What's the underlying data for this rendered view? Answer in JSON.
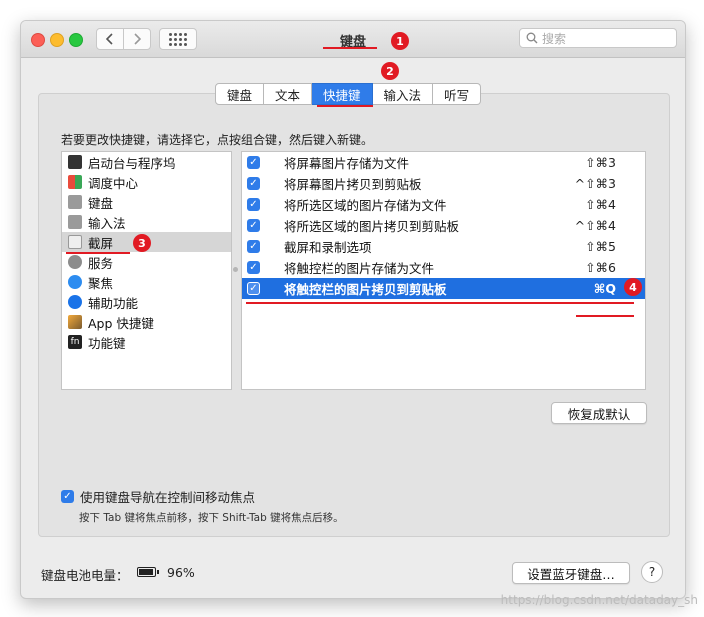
{
  "window": {
    "title": "键盘",
    "search_placeholder": "搜索"
  },
  "tabs": [
    {
      "label": "键盘",
      "active": false
    },
    {
      "label": "文本",
      "active": false
    },
    {
      "label": "快捷键",
      "active": true
    },
    {
      "label": "输入法",
      "active": false
    },
    {
      "label": "听写",
      "active": false
    }
  ],
  "instruction": "若要更改快捷键，请选择它，点按组合键，然后键入新键。",
  "categories": [
    {
      "label": "启动台与程序坞",
      "icon": "launchpad-icon"
    },
    {
      "label": "调度中心",
      "icon": "mission-control-icon"
    },
    {
      "label": "键盘",
      "icon": "keyboard-icon"
    },
    {
      "label": "输入法",
      "icon": "input-method-icon"
    },
    {
      "label": "截屏",
      "icon": "screenshot-icon",
      "selected": true
    },
    {
      "label": "服务",
      "icon": "services-gear-icon"
    },
    {
      "label": "聚焦",
      "icon": "spotlight-icon"
    },
    {
      "label": "辅助功能",
      "icon": "accessibility-icon"
    },
    {
      "label": "App 快捷键",
      "icon": "app-shortcuts-icon"
    },
    {
      "label": "功能键",
      "icon": "fn-key-icon",
      "glyph": "fn"
    }
  ],
  "shortcuts": [
    {
      "checked": true,
      "label": "将屏幕图片存储为文件",
      "keys": "⇧⌘3"
    },
    {
      "checked": true,
      "label": "将屏幕图片拷贝到剪贴板",
      "keys": "^⇧⌘3"
    },
    {
      "checked": true,
      "label": "将所选区域的图片存储为文件",
      "keys": "⇧⌘4"
    },
    {
      "checked": true,
      "label": "将所选区域的图片拷贝到剪贴板",
      "keys": "^⇧⌘4"
    },
    {
      "checked": true,
      "label": "截屏和录制选项",
      "keys": "⇧⌘5"
    },
    {
      "checked": true,
      "label": "将触控栏的图片存储为文件",
      "keys": "⇧⌘6"
    },
    {
      "checked": true,
      "label": "将触控栏的图片拷贝到剪贴板",
      "keys": "⌘Q",
      "selected": true
    }
  ],
  "buttons": {
    "restore_defaults": "恢复成默认",
    "setup_bluetooth_keyboard": "设置蓝牙键盘…",
    "help": "?"
  },
  "keyboard_navigation": {
    "checked": true,
    "label": "使用键盘导航在控制间移动焦点",
    "hint": "按下 Tab 键将焦点前移，按下 Shift-Tab 键将焦点后移。"
  },
  "battery": {
    "label": "键盘电池电量：",
    "percent": "96%",
    "level": 0.96
  },
  "annotations": {
    "badge_1": "1",
    "badge_2": "2",
    "badge_3": "3",
    "badge_4": "4",
    "color": "#e11a23"
  },
  "watermark": "https://blog.csdn.net/dataday_sh",
  "colors": {
    "accent": "#2f7ce9",
    "selection": "#1f6fe0"
  }
}
